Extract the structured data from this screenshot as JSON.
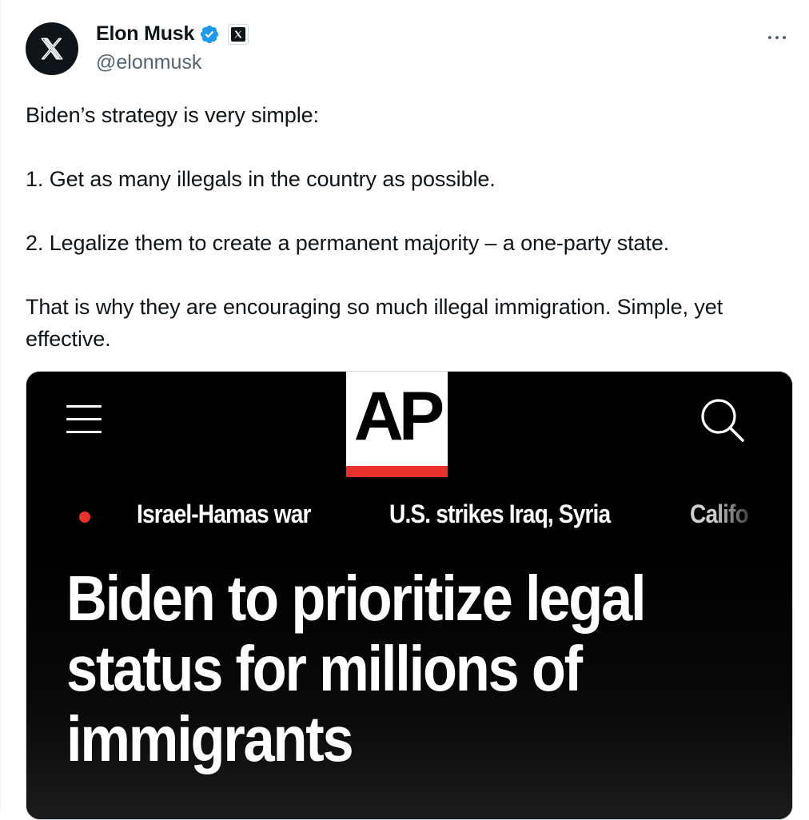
{
  "author": {
    "display_name": "Elon Musk",
    "handle": "@elonmusk",
    "avatar_icon": "x-logo-icon",
    "verified_icon": "verified-badge-icon",
    "affiliation_icon": "x-affiliation-icon"
  },
  "menu": {
    "more_icon": "more-icon"
  },
  "tweet": {
    "lines": [
      "Biden’s strategy is very simple:",
      "1. Get as many illegals in the country as possible.",
      "2. Legalize them to create a permanent majority – a one-party state.",
      "That is why they are encouraging so much illegal immigration. Simple, yet effective."
    ]
  },
  "media": {
    "logo_text": "AP",
    "menu_icon": "hamburger-menu-icon",
    "search_icon": "search-icon",
    "trending": [
      "Israel-Hamas war",
      "U.S. strikes Iraq, Syria",
      "Califo"
    ],
    "headline": "Biden to prioritize legal status for millions of immigrants"
  },
  "colors": {
    "verified_blue": "#1d9bf0",
    "ap_red": "#e8322b",
    "text_primary": "#0f1419",
    "text_secondary": "#536471"
  }
}
